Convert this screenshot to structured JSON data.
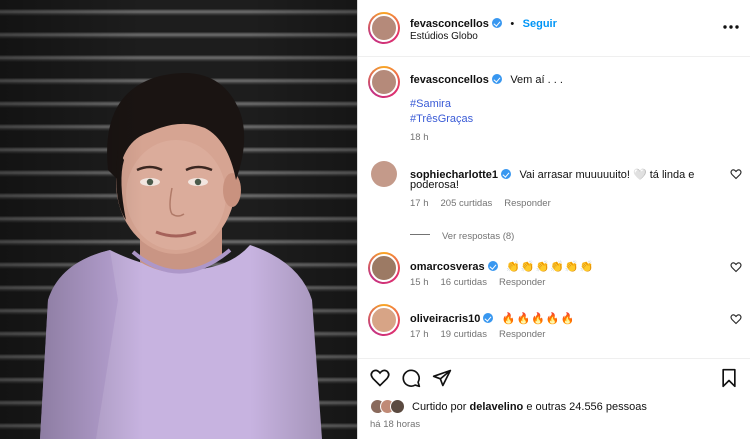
{
  "post": {
    "author": "fevasconcellos",
    "follow_label": "Seguir",
    "location": "Estúdios Globo",
    "more_icon": "more-horizontal-icon",
    "caption_text": "Vem aí . . .",
    "hashtags": [
      "#Samira",
      "#TrêsGraças"
    ],
    "time": "18 h"
  },
  "comments": [
    {
      "username": "sophiecharlotte1",
      "text_line1": "Vai arrasar muuuuuito! 🤍 tá linda e",
      "text_line2": "poderosa!",
      "time": "17 h",
      "likes": "205 curtidas",
      "reply": "Responder",
      "view_replies": "Ver respostas (8)"
    },
    {
      "username": "omarcosveras",
      "text": "👏👏👏👏👏👏",
      "time": "15 h",
      "likes": "16 curtidas",
      "reply": "Responder"
    },
    {
      "username": "oliveiracris10",
      "text": "🔥🔥🔥🔥🔥",
      "time": "17 h",
      "likes": "19 curtidas",
      "reply": "Responder"
    }
  ],
  "actions": {
    "like_icon": "heart-icon",
    "comment_icon": "comment-icon",
    "share_icon": "share-icon",
    "save_icon": "bookmark-icon"
  },
  "likes_summary": {
    "prefix": "Curtido por",
    "user": "delavelino",
    "suffix": "e outras 24.556 pessoas"
  },
  "posted_ago": "há 18 horas",
  "colors": {
    "accent_blue": "#0095f6",
    "hashtag_blue": "#3a5bd6",
    "shirt_lilac": "#c7b3e0"
  }
}
